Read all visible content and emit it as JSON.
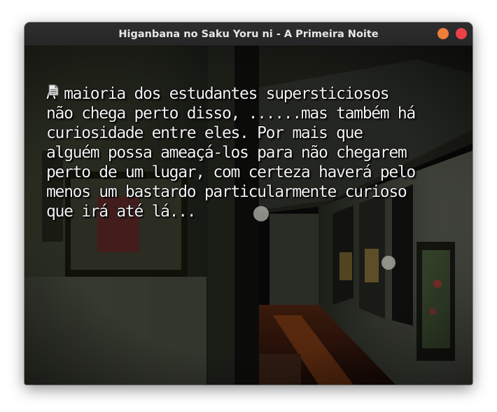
{
  "window": {
    "title": "Higanbana no Saku Yoru ni - A Primeira Noite",
    "minimize_color": "#f07d3c",
    "close_color": "#ec4148",
    "titlebar_color": "#2b2b2b"
  },
  "dialogue": {
    "lines": [
      "A maioria dos estudantes supersticiosos",
      "não chega perto disso, ......mas também há",
      "curiosidade entre eles. Por mais que",
      "alguém possa ameaçá-los para não chegarem",
      "perto de um lugar, com certeza haverá pelo",
      "menos um bastardo particularmente curioso",
      "que irá até lá..."
    ],
    "text_color": "#f2f2f2",
    "continue_icon": "page-icon"
  },
  "scene": {
    "description_icon": "school-hallway-background"
  }
}
